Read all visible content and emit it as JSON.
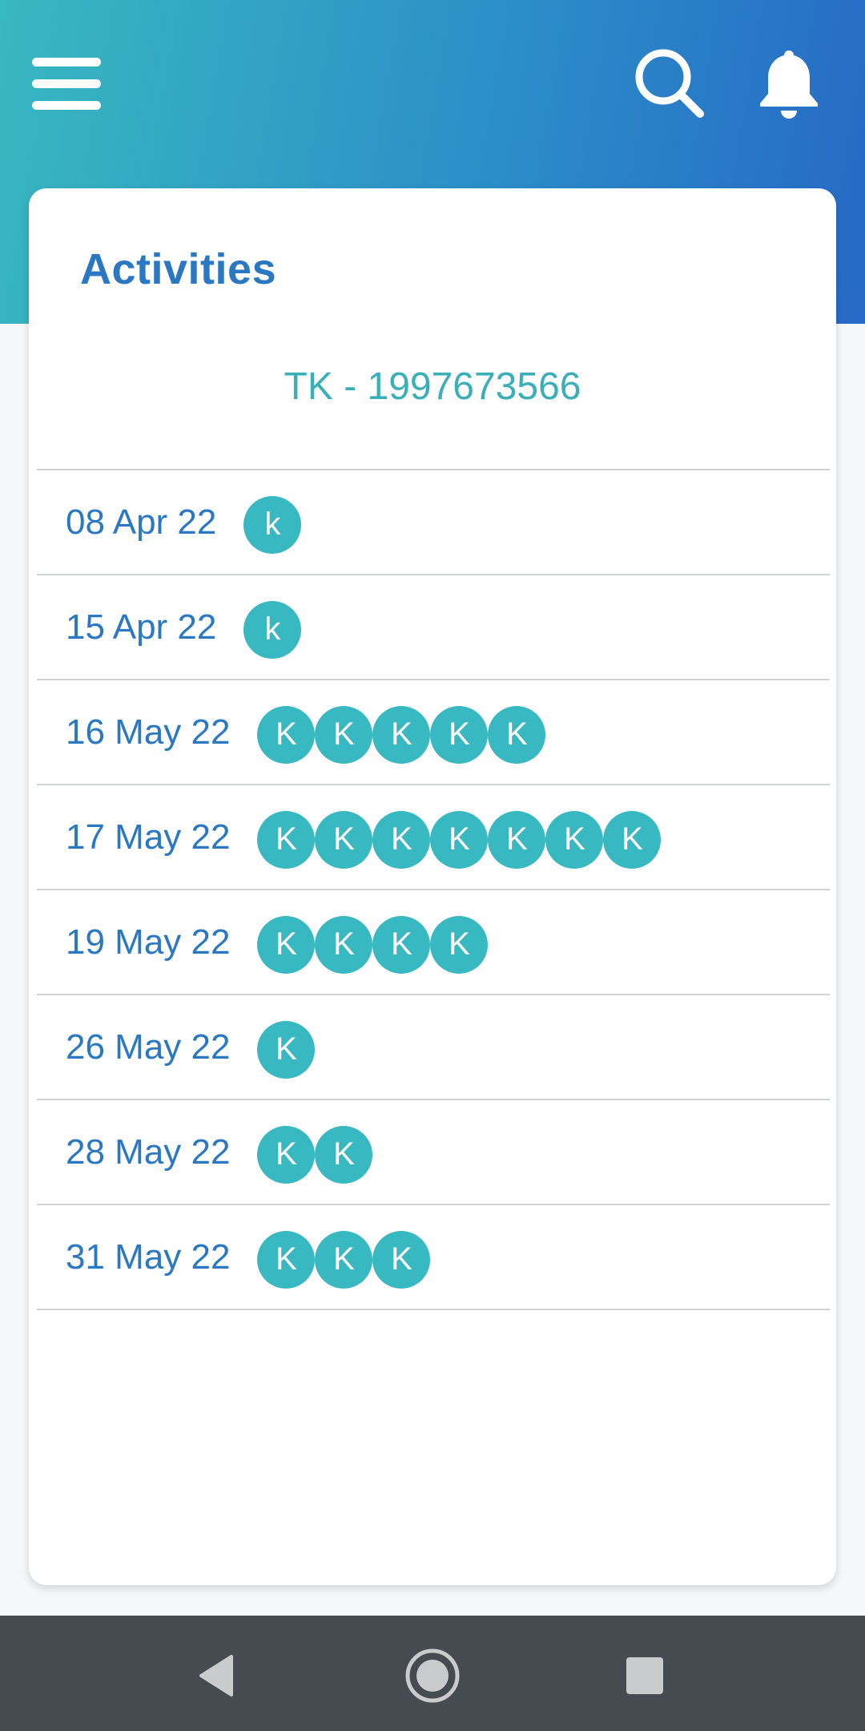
{
  "header": {
    "menu_icon": "hamburger-menu-icon",
    "search_icon": "search-icon",
    "notification_icon": "bell-icon",
    "gradient_start": "#38b8c0",
    "gradient_end": "#2669c6"
  },
  "card": {
    "title": "Activities",
    "subtitle": "TK - 1997673566"
  },
  "activities": [
    {
      "date": "08 Apr 22",
      "badges": [
        "k"
      ]
    },
    {
      "date": "15 Apr 22",
      "badges": [
        "k"
      ]
    },
    {
      "date": "16 May 22",
      "badges": [
        "K",
        "K",
        "K",
        "K",
        "K"
      ]
    },
    {
      "date": "17 May 22",
      "badges": [
        "K",
        "K",
        "K",
        "K",
        "K",
        "K",
        "K"
      ]
    },
    {
      "date": "19 May 22",
      "badges": [
        "K",
        "K",
        "K",
        "K"
      ]
    },
    {
      "date": "26 May 22",
      "badges": [
        "K"
      ]
    },
    {
      "date": "28 May 22",
      "badges": [
        "K",
        "K"
      ]
    },
    {
      "date": "31 May 22",
      "badges": [
        "K",
        "K",
        "K"
      ]
    }
  ],
  "navbar": {
    "back_icon": "back-triangle-icon",
    "home_icon": "home-circle-icon",
    "recents_icon": "recents-square-icon"
  },
  "colors": {
    "accent_blue": "#2a78c2",
    "accent_teal": "#38b8c0",
    "navbar": "#454b51"
  }
}
